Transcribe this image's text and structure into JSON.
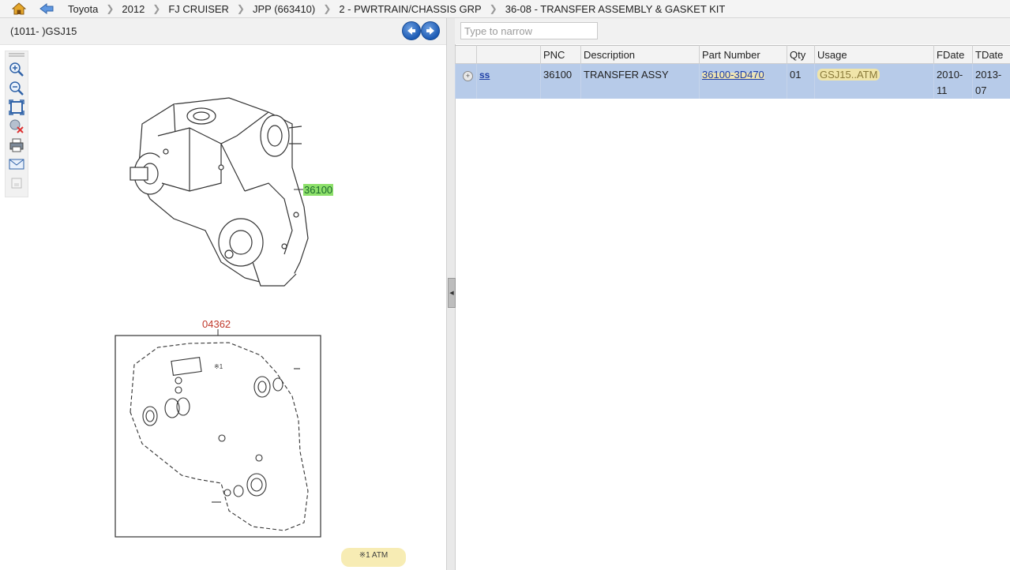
{
  "breadcrumb": {
    "items": [
      "Toyota",
      "2012",
      "FJ CRUISER",
      "JPP (663410)",
      "2 - PWRTRAIN/CHASSIS GRP",
      "36-08 - TRANSFER ASSEMBLY & GASKET KIT"
    ]
  },
  "left_panel": {
    "title": "(1011- )GSJ15",
    "callout_assy": "36100",
    "callout_kit": "04362",
    "kit_note_mark": "※1",
    "atm_note": "※1 ATM"
  },
  "right_panel": {
    "search_placeholder": "Type to narrow",
    "columns": [
      "",
      "",
      "PNC",
      "Description",
      "Part Number",
      "Qty",
      "Usage",
      "FDate",
      "TDate"
    ],
    "rows": [
      {
        "ss": "ss",
        "pnc": "36100",
        "description": "TRANSFER ASSY",
        "part_number": "36100-3D470",
        "qty": "01",
        "usage": "GSJ15..ATM",
        "fdate": "2010-11",
        "tdate": "2013-07"
      }
    ]
  },
  "icons": [
    "home-icon",
    "back-arrow-icon",
    "zoom-in-icon",
    "zoom-out-icon",
    "fit-icon",
    "clear-icon",
    "print-icon",
    "email-icon",
    "export-icon"
  ],
  "colors": {
    "selected_row": "#b7cbe9",
    "callout_highlight": "#8de06a",
    "kit_label": "#c0392b",
    "link": "#1f3fa6"
  }
}
